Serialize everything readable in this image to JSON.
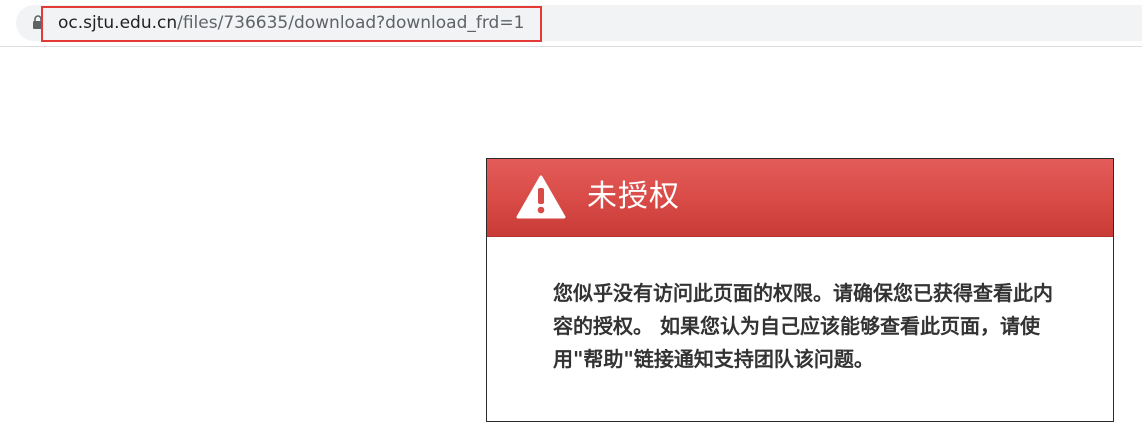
{
  "address_bar": {
    "host": "oc.sjtu.edu.cn",
    "path": "/files/736635/download?download_frd=1",
    "icon": "lock-icon"
  },
  "error": {
    "icon": "warning-icon",
    "title": "未授权",
    "message": "您似乎没有访问此页面的权限。请确保您已获得查看此内容的授权。 如果您认为自己应该能够查看此页面，请使用\"帮助\"链接通知支持团队该问题。",
    "colors": {
      "header": "#d84a46",
      "title_text": "#ffffff",
      "message_text": "#333333"
    }
  },
  "annotation": {
    "highlight_color": "#e53935"
  }
}
